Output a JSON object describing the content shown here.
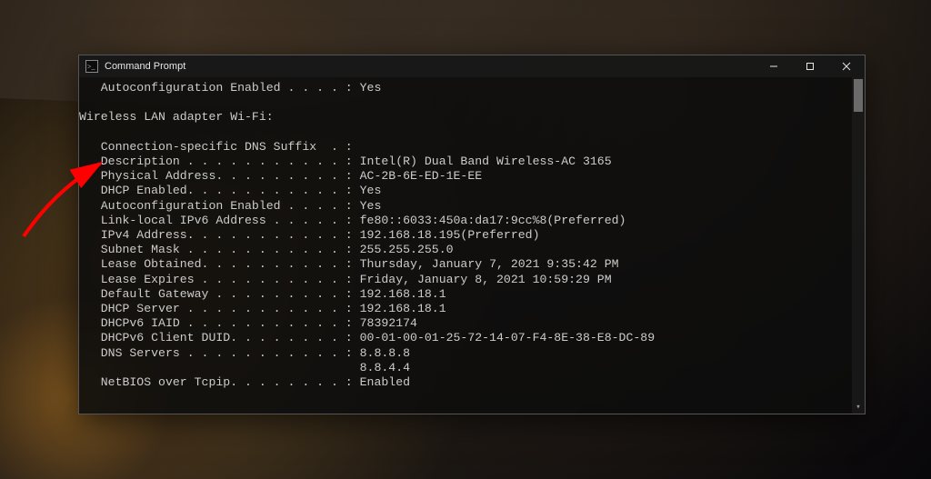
{
  "window": {
    "title": "Command Prompt"
  },
  "terminal": {
    "lines": [
      "   Autoconfiguration Enabled . . . . : Yes",
      "",
      "Wireless LAN adapter Wi-Fi:",
      "",
      "   Connection-specific DNS Suffix  . :",
      "   Description . . . . . . . . . . . : Intel(R) Dual Band Wireless-AC 3165",
      "   Physical Address. . . . . . . . . : AC-2B-6E-ED-1E-EE",
      "   DHCP Enabled. . . . . . . . . . . : Yes",
      "   Autoconfiguration Enabled . . . . : Yes",
      "   Link-local IPv6 Address . . . . . : fe80::6033:450a:da17:9cc%8(Preferred)",
      "   IPv4 Address. . . . . . . . . . . : 192.168.18.195(Preferred)",
      "   Subnet Mask . . . . . . . . . . . : 255.255.255.0",
      "   Lease Obtained. . . . . . . . . . : Thursday, January 7, 2021 9:35:42 PM",
      "   Lease Expires . . . . . . . . . . : Friday, January 8, 2021 10:59:29 PM",
      "   Default Gateway . . . . . . . . . : 192.168.18.1",
      "   DHCP Server . . . . . . . . . . . : 192.168.18.1",
      "   DHCPv6 IAID . . . . . . . . . . . : 78392174",
      "   DHCPv6 Client DUID. . . . . . . . : 00-01-00-01-25-72-14-07-F4-8E-38-E8-DC-89",
      "   DNS Servers . . . . . . . . . . . : 8.8.8.8",
      "                                       8.8.4.4",
      "   NetBIOS over Tcpip. . . . . . . . : Enabled"
    ]
  },
  "annotation": {
    "arrow_color": "#ff0000"
  }
}
